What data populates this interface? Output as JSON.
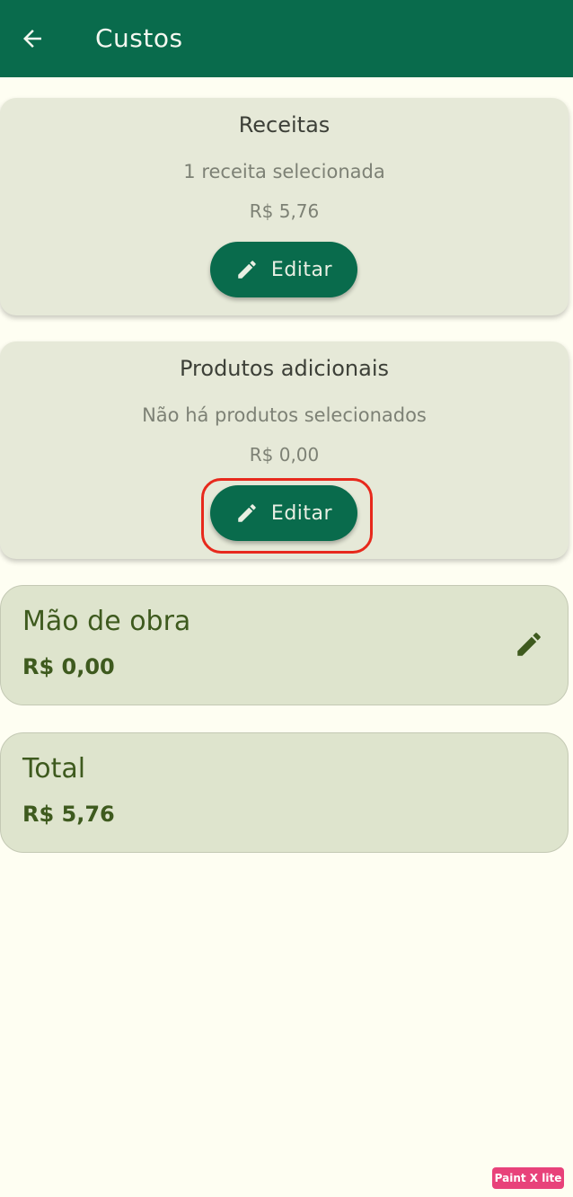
{
  "appbar": {
    "title": "Custos"
  },
  "recipes": {
    "title": "Receitas",
    "subtitle": "1 receita selecionada",
    "value": "R$ 5,76",
    "edit_label": "Editar"
  },
  "extras": {
    "title": "Produtos adicionais",
    "subtitle": "Não há produtos selecionados",
    "value": "R$ 0,00",
    "edit_label": "Editar"
  },
  "labor": {
    "label": "Mão de obra",
    "value": "R$ 0,00"
  },
  "total": {
    "label": "Total",
    "value": "R$ 5,76"
  },
  "watermark": {
    "text": "Paint X lite"
  },
  "colors": {
    "primary": "#096b4c",
    "card": "#e6e9d8",
    "highlight": "#e7291c",
    "accent_text": "#3e5a1e"
  },
  "icons": {
    "back": "arrow-left-icon",
    "edit": "pencil-icon"
  }
}
